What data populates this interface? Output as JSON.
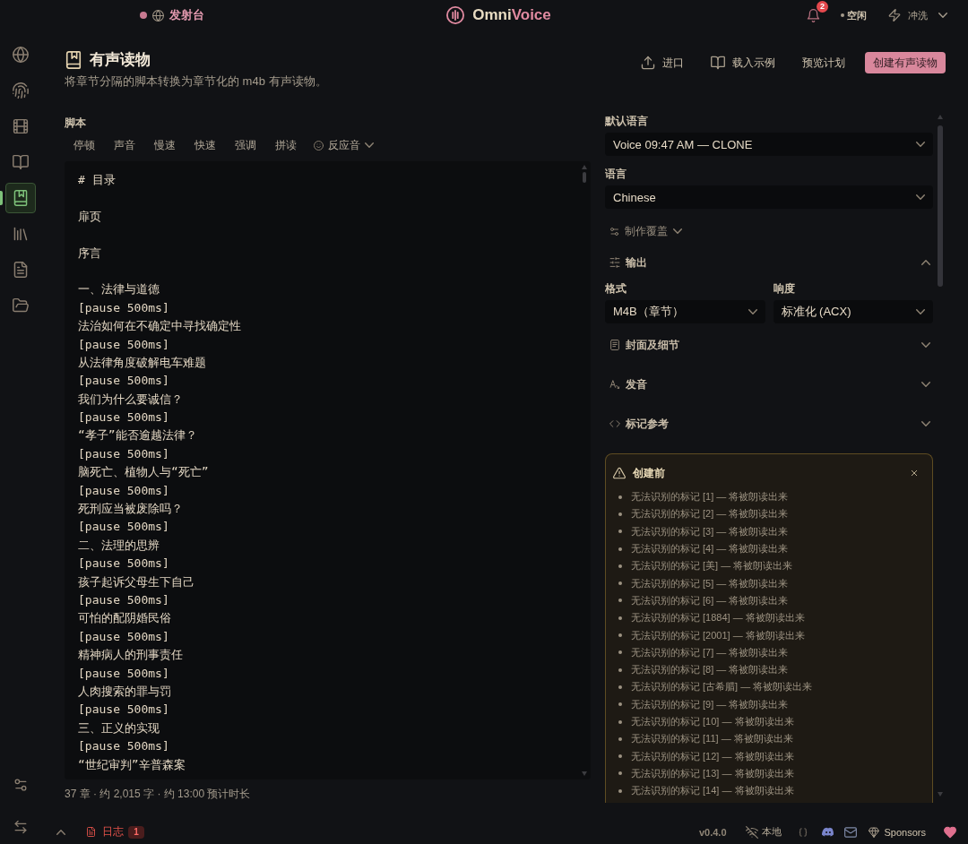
{
  "topbar": {
    "station": {
      "label": "发射台"
    },
    "brand": {
      "primary": "Omni",
      "accent": "Voice"
    },
    "notifications": {
      "count": "2"
    },
    "status": "空闲",
    "flush": {
      "label": "冲洗"
    }
  },
  "sidebar": {
    "items": [
      {
        "selected": false
      },
      {
        "selected": false
      },
      {
        "selected": false
      },
      {
        "selected": false
      },
      {
        "selected": true
      },
      {
        "selected": false
      },
      {
        "selected": false
      },
      {
        "selected": false
      }
    ]
  },
  "header": {
    "title": "有声读物",
    "subtitle": "将章节分隔的脚本转换为章节化的 m4b 有声读物。",
    "actions": [
      {
        "label": "进口",
        "kind": "ghost"
      },
      {
        "label": "载入示例",
        "kind": "ghost"
      },
      {
        "label": "预览计划",
        "kind": "ghost"
      },
      {
        "label": "创建有声读物",
        "kind": "primary"
      }
    ]
  },
  "script": {
    "label": "脚本",
    "tools": [
      {
        "label": "停顿",
        "kind": "plain"
      },
      {
        "label": "声音",
        "kind": "plain"
      },
      {
        "label": "慢速",
        "kind": "plain"
      },
      {
        "label": "快速",
        "kind": "plain"
      },
      {
        "label": "强调",
        "kind": "plain"
      },
      {
        "label": "拼读",
        "kind": "plain"
      },
      {
        "label": "反应音",
        "kind": "menu"
      }
    ],
    "paragraphs": [
      [
        "# 目录"
      ],
      [
        "扉页"
      ],
      [
        "序言"
      ],
      [
        "一、法律与道德",
        "[pause 500ms]",
        "法治如何在不确定中寻找确定性",
        "[pause 500ms]",
        "从法律角度破解电车难题",
        "[pause 500ms]",
        "我们为什么要诚信？",
        "[pause 500ms]",
        "“孝子”能否逾越法律？",
        "[pause 500ms]",
        "脑死亡、植物人与“死亡”",
        "[pause 500ms]",
        "死刑应当被废除吗？",
        "[pause 500ms]",
        "二、法理的思辨",
        "[pause 500ms]",
        "孩子起诉父母生下自己",
        "[pause 500ms]",
        "可怕的配阴婚民俗",
        "[pause 500ms]",
        "精神病人的刑事责任",
        "[pause 500ms]",
        "人肉搜索的罪与罚",
        "[pause 500ms]",
        "三、正义的实现",
        "[pause 500ms]",
        "“世纪审判”辛普森案"
      ]
    ],
    "stats": "37 章 · 约 2,015 字 · 约 13:00 预计时长"
  },
  "settings": {
    "fields": [
      {
        "label": "默认语言",
        "value": "Voice 09:47 AM — CLONE"
      },
      {
        "label": "语言",
        "value": "Chinese"
      }
    ],
    "overrides": {
      "label": "制作覆盖",
      "expanded": false
    },
    "sections": [
      {
        "label": "输出",
        "expanded": true,
        "fields": [
          {
            "label": "格式",
            "value": "M4B（章节）"
          },
          {
            "label": "响度",
            "value": "标准化 (ACX)"
          }
        ]
      },
      {
        "label": "封面及细节",
        "expanded": false
      },
      {
        "label": "发音",
        "expanded": false
      },
      {
        "label": "标记参考",
        "expanded": false
      }
    ]
  },
  "warning": {
    "title": "创建前",
    "items": [
      "无法识别的标记 [1] — 将被朗读出来",
      "无法识别的标记 [2] — 将被朗读出来",
      "无法识别的标记 [3] — 将被朗读出来",
      "无法识别的标记 [4] — 将被朗读出来",
      "无法识别的标记 [美] — 将被朗读出来",
      "无法识别的标记 [5] — 将被朗读出来",
      "无法识别的标记 [6] — 将被朗读出来",
      "无法识别的标记 [1884] — 将被朗读出来",
      "无法识别的标记 [2001] — 将被朗读出来",
      "无法识别的标记 [7] — 将被朗读出来",
      "无法识别的标记 [8] — 将被朗读出来",
      "无法识别的标记 [古希腊] — 将被朗读出来",
      "无法识别的标记 [9] — 将被朗读出来",
      "无法识别的标记 [10] — 将被朗读出来",
      "无法识别的标记 [11] — 将被朗读出来",
      "无法识别的标记 [12] — 将被朗读出来",
      "无法识别的标记 [13] — 将被朗读出来",
      "无法识别的标记 [14] — 将被朗读出来"
    ]
  },
  "status_bar": {
    "log": {
      "label": "日志",
      "count": "1"
    },
    "version": "v0.4.0",
    "connection": "本地",
    "sponsors": "Sponsors"
  }
}
